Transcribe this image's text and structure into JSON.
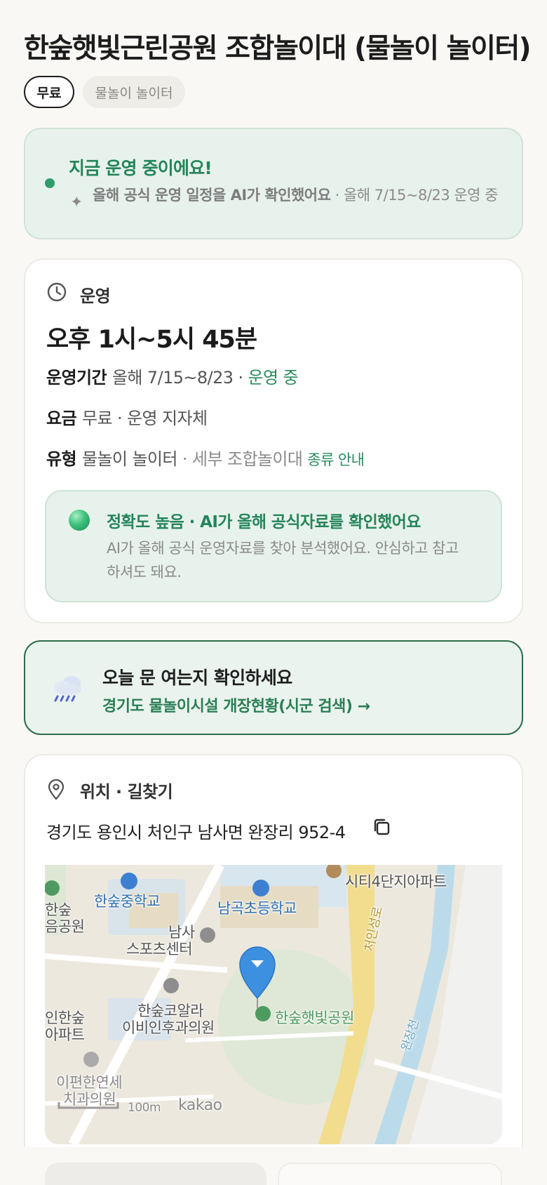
{
  "header": {
    "title": "한숲햇빛근린공원 조합놀이대 (물놀이 놀이터)",
    "chips": {
      "free": "무료",
      "type": "물놀이 놀이터"
    }
  },
  "status": {
    "title": "지금 운영 중이에요!",
    "ai_note": "올해 공식 운영 일정을 AI가 확인했어요",
    "period_note": " · 올해 7/15~8/23 운영 중",
    "sparkle": "✦"
  },
  "operation": {
    "section_title": "운영",
    "hours": "오후 1시~5시 45분",
    "period": {
      "label": "운영기간",
      "value": "올해 7/15~8/23 · ",
      "status": "운영 중"
    },
    "fee": {
      "label": "요금",
      "value": "무료 · 운영 지자체"
    },
    "type": {
      "label": "유형",
      "value": "물놀이 놀이터",
      "detail": " · 세부 조합놀이대 ",
      "link": "종류 안내"
    },
    "accuracy": {
      "title": "정확도 높음 · AI가 올해 공식자료를 확인했어요",
      "text": "AI가 올해 공식 운영자료를 찾아 분석했어요. 안심하고 참고하셔도 돼요."
    }
  },
  "check": {
    "title": "오늘 문 여는지 확인하세요",
    "link": "경기도 물놀이시설 개장현황(시군 검색) →"
  },
  "location": {
    "section_title": "위치 · 길찾기",
    "address": "경기도 용인시 처인구 남사면 완장리 952-4",
    "map": {
      "labels": {
        "school_middle": "한숲중학교",
        "school_elem": "남곡초등학교",
        "apt": "시티4단지아파트",
        "sports1": "남사",
        "sports2": "스포츠센터",
        "hospital1": "한숲코알라",
        "hospital2": "이비인후과의원",
        "park": "한숲햇빛공원",
        "road": "처인성로",
        "stream": "완장천",
        "left_park1": "한숲",
        "left_park2": "음공원",
        "left_apt1": "인한숲",
        "left_apt2": "아파트",
        "dental1": "이편한연세",
        "dental2": "치과의원",
        "scale": "100m",
        "brand": "kakao"
      }
    }
  },
  "colors": {
    "accent_green": "#2a8a5d",
    "pin_blue": "#3d8fe0",
    "background": "#f9f8f5"
  }
}
